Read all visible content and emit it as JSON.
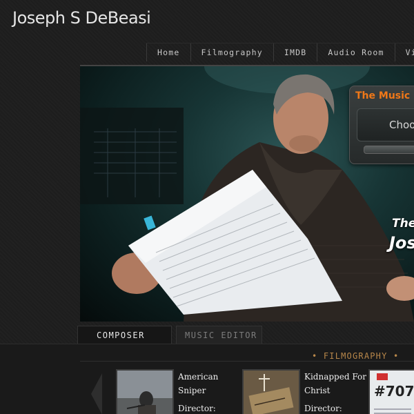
{
  "site": {
    "title": "Joseph S DeBeasi"
  },
  "nav": {
    "items": [
      {
        "label": "Home"
      },
      {
        "label": "Filmography"
      },
      {
        "label": "IMDB"
      },
      {
        "label": "Audio Room"
      },
      {
        "label": "Videos"
      }
    ]
  },
  "hero": {
    "tagline_line1": "The",
    "tagline_line2": "Jos",
    "music_widget": {
      "title": "The Music",
      "choose_label": "Choos",
      "title_color": "#f07818"
    }
  },
  "tabs": [
    {
      "label": "COMPOSER",
      "active": true
    },
    {
      "label": "MUSIC EDITOR",
      "active": false
    }
  ],
  "filmography": {
    "heading": "• FILMOGRAPHY •",
    "films": [
      {
        "title": "American Sniper",
        "director_label": "Director:"
      },
      {
        "title": "Kidnapped For Christ",
        "director_label": "Director:"
      },
      {
        "poster_text": "#707"
      }
    ]
  },
  "colors": {
    "background": "#1e1e1e",
    "accent_orange": "#f07818",
    "filmography_heading": "#b8874a"
  }
}
